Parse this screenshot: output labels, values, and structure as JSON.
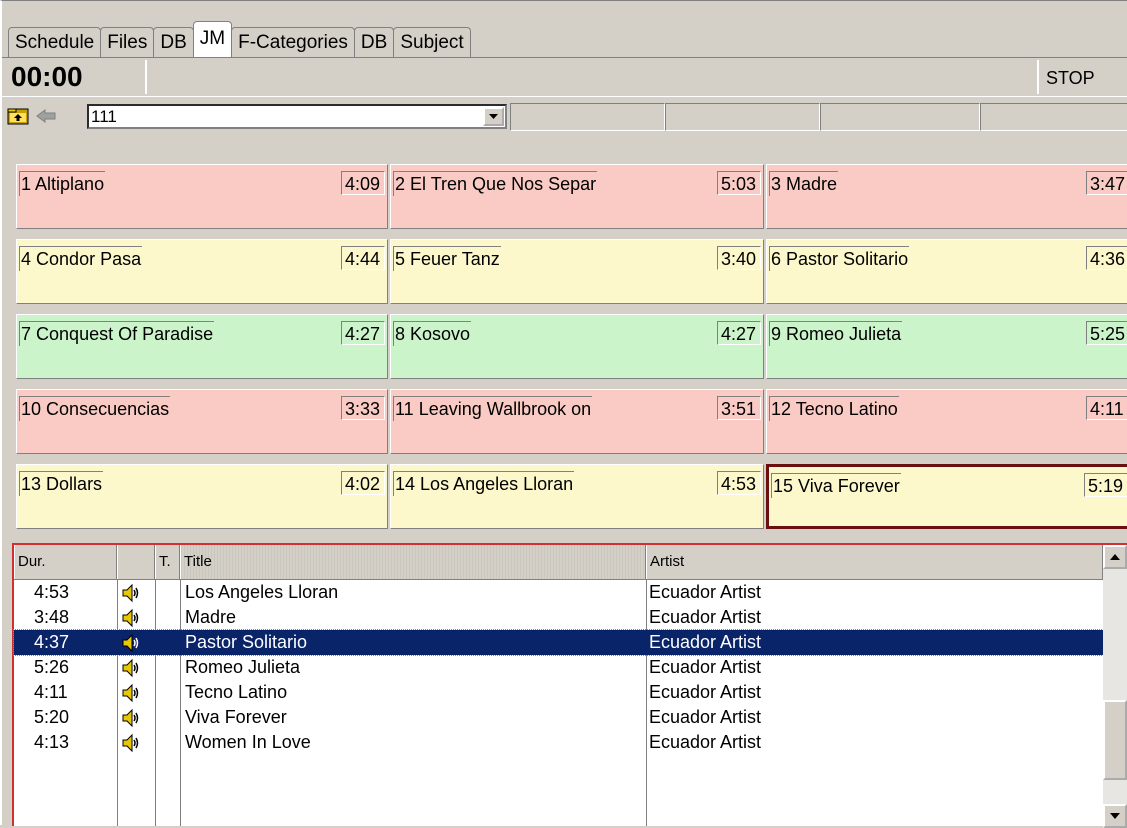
{
  "tabs": [
    {
      "label": "Schedule"
    },
    {
      "label": "Files"
    },
    {
      "label": "DB"
    },
    {
      "label": "JM"
    },
    {
      "label": "F-Categories"
    },
    {
      "label": "DB"
    },
    {
      "label": "Subject"
    }
  ],
  "active_tab": "JM",
  "timer": {
    "value": "00:00",
    "stop_label": "STOP"
  },
  "toolbar": {
    "combo_value": "111",
    "folder_icon": "folder-up-icon",
    "back_icon": "back-arrow-icon"
  },
  "cells": [
    {
      "num": "1",
      "name": "Altiplano",
      "dur": "4:09",
      "color": "pink"
    },
    {
      "num": "2",
      "name": "El Tren Que Nos Separ",
      "dur": "5:03",
      "color": "pink"
    },
    {
      "num": "3",
      "name": "Madre",
      "dur": "3:47",
      "color": "pink"
    },
    {
      "num": "4",
      "name": "Condor Pasa",
      "dur": "4:44",
      "color": "yellow"
    },
    {
      "num": "5",
      "name": "Feuer Tanz",
      "dur": "3:40",
      "color": "yellow"
    },
    {
      "num": "6",
      "name": "Pastor Solitario",
      "dur": "4:36",
      "color": "yellow"
    },
    {
      "num": "7",
      "name": "Conquest Of Paradise",
      "dur": "4:27",
      "color": "green"
    },
    {
      "num": "8",
      "name": "Kosovo",
      "dur": "4:27",
      "color": "green"
    },
    {
      "num": "9",
      "name": "Romeo Julieta",
      "dur": "5:25",
      "color": "green"
    },
    {
      "num": "10",
      "name": "Consecuencias",
      "dur": "3:33",
      "color": "pink"
    },
    {
      "num": "11",
      "name": "Leaving Wallbrook on",
      "dur": "3:51",
      "color": "pink"
    },
    {
      "num": "12",
      "name": "Tecno Latino",
      "dur": "4:11",
      "color": "pink"
    },
    {
      "num": "13",
      "name": "Dollars",
      "dur": "4:02",
      "color": "yellow"
    },
    {
      "num": "14",
      "name": "Los Angeles Lloran",
      "dur": "4:53",
      "color": "yellow"
    },
    {
      "num": "15",
      "name": "Viva Forever",
      "dur": "5:19",
      "color": "yellow",
      "selected": true
    }
  ],
  "colors": {
    "pink": "#f9cbc4",
    "yellow": "#fcf8cc",
    "green": "#cbf4cb",
    "selection": "#0a246a",
    "selected_cell_border": "#6b1010"
  },
  "list": {
    "headers": {
      "dur": "Dur.",
      "icon": "",
      "type": "T.",
      "title": "Title",
      "artist": "Artist"
    },
    "rows": [
      {
        "dur": "4:53",
        "title": "Los Angeles Lloran",
        "artist": "Ecuador Artist",
        "icon": "speaker-icon"
      },
      {
        "dur": "3:48",
        "title": "Madre",
        "artist": "Ecuador Artist",
        "icon": "speaker-icon"
      },
      {
        "dur": "4:37",
        "title": "Pastor Solitario",
        "artist": "Ecuador Artist",
        "icon": "speaker-icon",
        "selected": true
      },
      {
        "dur": "5:26",
        "title": "Romeo Julieta",
        "artist": "Ecuador Artist",
        "icon": "speaker-icon"
      },
      {
        "dur": "4:11",
        "title": "Tecno Latino",
        "artist": "Ecuador Artist",
        "icon": "speaker-icon"
      },
      {
        "dur": "5:20",
        "title": "Viva Forever",
        "artist": "Ecuador Artist",
        "icon": "speaker-icon"
      },
      {
        "dur": "4:13",
        "title": "Women In Love",
        "artist": "Ecuador Artist",
        "icon": "speaker-icon"
      }
    ]
  }
}
